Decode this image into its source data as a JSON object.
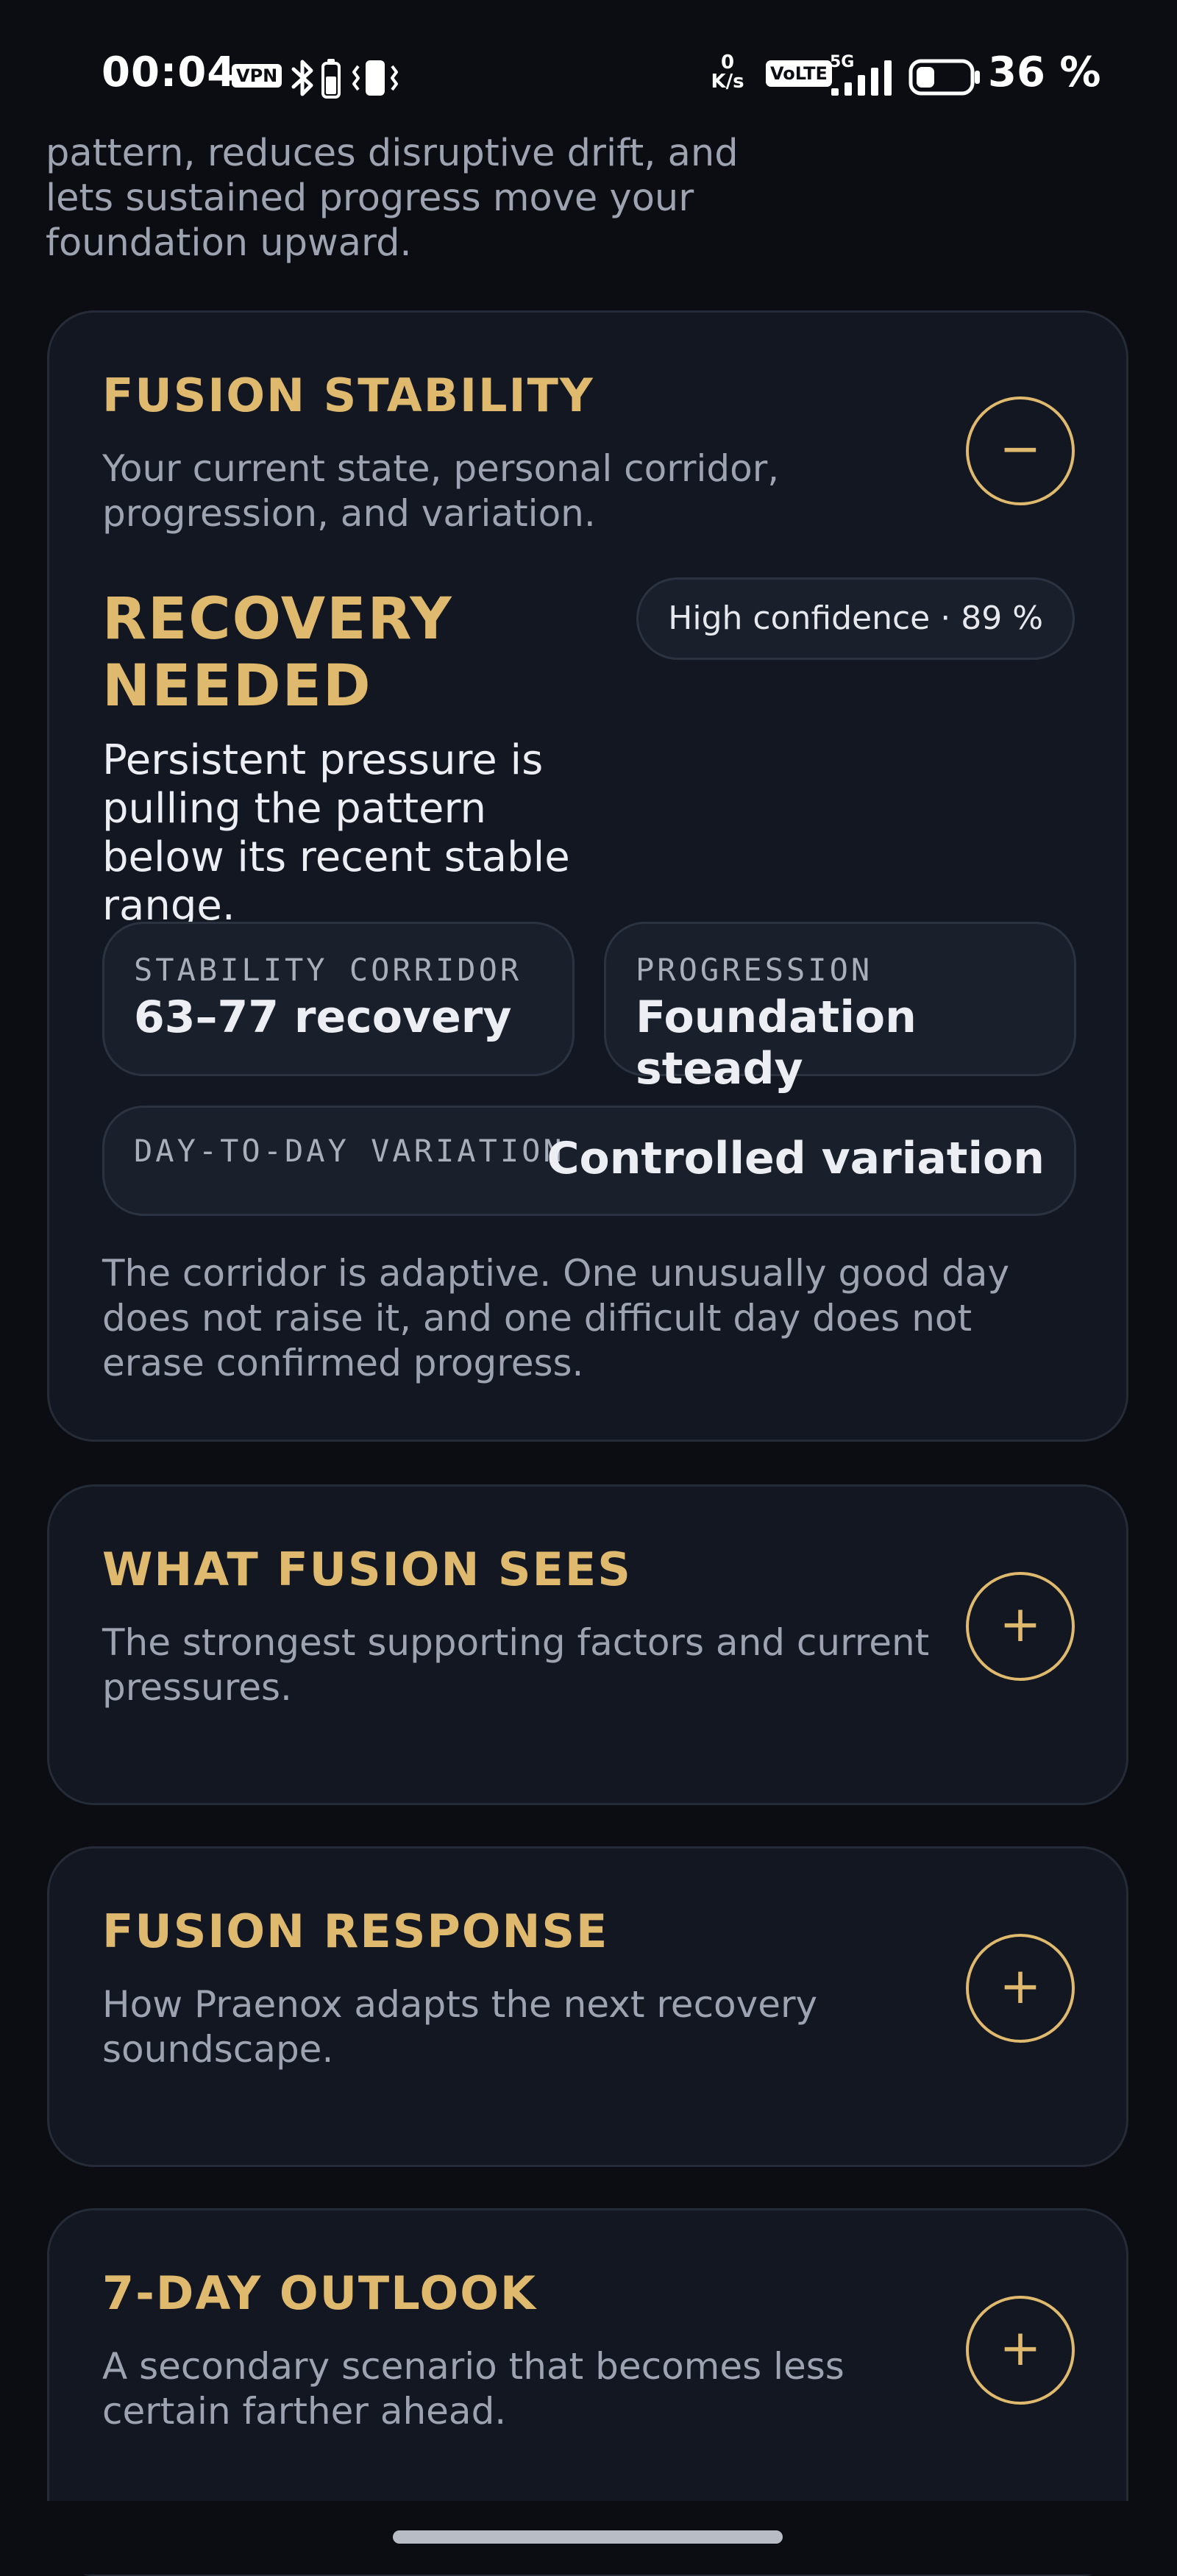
{
  "status_bar": {
    "time": "00:04",
    "vpn_label": "VPN",
    "net_speed_value": "0",
    "net_speed_unit": "K/s",
    "volte_label": "VoLTE",
    "network_label": "5G",
    "battery_percent": "36 %",
    "battery_level": 0.36,
    "colors": {
      "text": "#ffffff"
    }
  },
  "intro": {
    "text": "pattern, reduces disruptive drift, and lets sustained progress move your foundation upward."
  },
  "cards": {
    "fusion_stability": {
      "title": "FUSION STABILITY",
      "subtitle": "Your current state, personal corridor, progression, and variation.",
      "toggle_symbol": "−",
      "state_title": "RECOVERY NEEDED",
      "confidence": "High confidence · 89 %",
      "state_description": "Persistent pressure is pulling the pattern below its recent stable range.",
      "metrics": {
        "corridor_label": "STABILITY CORRIDOR",
        "corridor_value": "63–77 recovery",
        "progression_label": "PROGRESSION",
        "progression_value": "Foundation steady",
        "variation_label": "DAY-TO-DAY VARIATION",
        "variation_value": "Controlled variation"
      },
      "note": "The corridor is adaptive. One unusually good day does not raise it, and one difficult day does not erase confirmed progress."
    },
    "what_fusion_sees": {
      "title": "WHAT FUSION SEES",
      "subtitle": "The strongest supporting factors and current pressures.",
      "toggle_symbol": "+"
    },
    "fusion_response": {
      "title": "FUSION RESPONSE",
      "subtitle": "How Praenox adapts the next recovery soundscape.",
      "toggle_symbol": "+"
    },
    "outlook": {
      "title": "7-DAY OUTLOOK",
      "subtitle": "A secondary scenario that becomes less certain farther ahead.",
      "toggle_symbol": "+"
    }
  },
  "icons": [
    "vpn-icon",
    "bluetooth-icon",
    "battery-small-icon",
    "vibrate-icon",
    "signal-icon",
    "battery-icon",
    "collapse-icon",
    "expand-icon"
  ],
  "colors": {
    "background": "#0b0d12",
    "card": "#121722",
    "card_border": "#252b37",
    "accent_gold": "#dfb96d",
    "muted_text": "#9da3b0",
    "primary_text": "#eceef3"
  }
}
